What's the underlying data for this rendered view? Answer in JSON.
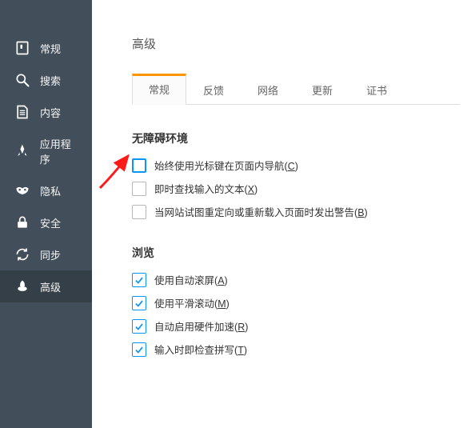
{
  "sidebar": {
    "items": [
      {
        "label": "常规"
      },
      {
        "label": "搜索"
      },
      {
        "label": "内容"
      },
      {
        "label": "应用程序"
      },
      {
        "label": "隐私"
      },
      {
        "label": "安全"
      },
      {
        "label": "同步"
      },
      {
        "label": "高级"
      }
    ],
    "active_index": 7
  },
  "page": {
    "title": "高级",
    "tabs": [
      {
        "label": "常规"
      },
      {
        "label": "反馈"
      },
      {
        "label": "网络"
      },
      {
        "label": "更新"
      },
      {
        "label": "证书"
      }
    ],
    "active_tab": 0
  },
  "sections": {
    "accessibility": {
      "title": "无障碍环境",
      "options": [
        {
          "label": "始终使用光标键在页面内导航",
          "hotkey": "C",
          "checked": false,
          "focused": true
        },
        {
          "label": "即时查找输入的文本",
          "hotkey": "X",
          "checked": false,
          "focused": false
        },
        {
          "label": "当网站试图重定向或重新载入页面时发出警告",
          "hotkey": "B",
          "checked": false,
          "focused": false
        }
      ]
    },
    "browsing": {
      "title": "浏览",
      "options": [
        {
          "label": "使用自动滚屏",
          "hotkey": "A",
          "checked": true,
          "focused": false
        },
        {
          "label": "使用平滑滚动",
          "hotkey": "M",
          "checked": true,
          "focused": false
        },
        {
          "label": "自动启用硬件加速",
          "hotkey": "R",
          "checked": true,
          "focused": false
        },
        {
          "label": "输入时即检查拼写",
          "hotkey": "T",
          "checked": true,
          "focused": false
        }
      ]
    }
  },
  "annotation": {
    "color": "#ff1a1a"
  }
}
